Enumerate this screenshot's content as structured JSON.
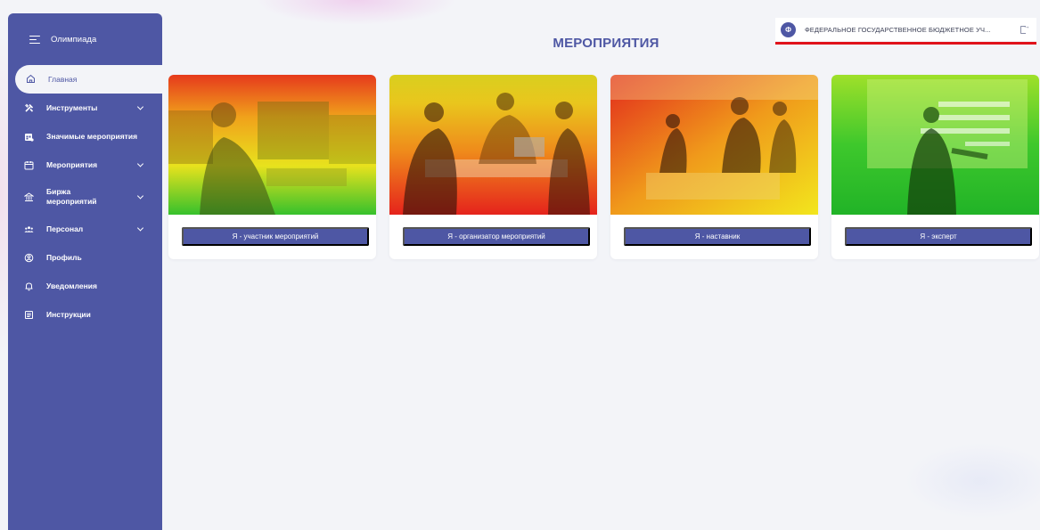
{
  "app": {
    "title": "Олимпиада"
  },
  "sidebar": {
    "active_item": {
      "label": "Главная",
      "icon": "home-icon"
    },
    "items": [
      {
        "label": "Инструменты",
        "icon": "tools-icon",
        "expandable": true
      },
      {
        "label": "Значимые мероприятия",
        "icon": "calendar-star-icon",
        "expandable": false
      },
      {
        "label": "Мероприятия",
        "icon": "calendar-icon",
        "expandable": true
      },
      {
        "label": "Биржа мероприятий",
        "icon": "exchange-icon",
        "expandable": true
      },
      {
        "label": "Персонал",
        "icon": "people-icon",
        "expandable": true
      },
      {
        "label": "Профиль",
        "icon": "profile-icon",
        "expandable": false
      },
      {
        "label": "Уведомления",
        "icon": "bell-icon",
        "expandable": false
      },
      {
        "label": "Инструкции",
        "icon": "document-icon",
        "expandable": false
      }
    ],
    "color": "#4e57a4"
  },
  "header": {
    "page_title": "МЕРОПРИЯТИЯ",
    "org": {
      "avatar_letter": "Ф",
      "name": "ФЕДЕРАЛЬНОЕ ГОСУДАРСТВЕННОЕ БЮДЖЕТНОЕ УЧ...",
      "underline_color": "#e0121b"
    }
  },
  "cards": [
    {
      "button_label": "Я - участник мероприятий",
      "image": "boy-at-workbench-photo"
    },
    {
      "button_label": "Я - организатор мероприятий",
      "image": "meeting-at-table-photo"
    },
    {
      "button_label": "Я - наставник",
      "image": "workshop-group-photo"
    },
    {
      "button_label": "Я - эксперт",
      "image": "speaker-on-stage-photo"
    }
  ],
  "colors": {
    "accent": "#4e57a4",
    "background": "#f3f4f8",
    "photo_gradient": [
      "#e3231c",
      "#f2a51a",
      "#f4e31c",
      "#2fbf2f"
    ]
  }
}
